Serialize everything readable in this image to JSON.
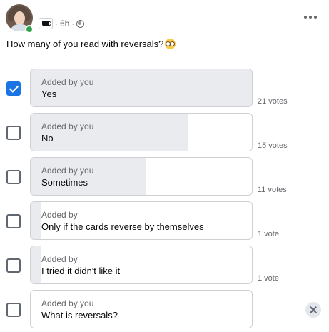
{
  "post": {
    "time": "6h",
    "text": "How many of you read with reversals?",
    "emoji": "nerd-face"
  },
  "poll": {
    "options": [
      {
        "added_by": "Added by you",
        "label": "Yes",
        "votes": "21 votes",
        "checked": true,
        "share": 1.0
      },
      {
        "added_by": "Added by you",
        "label": "No",
        "votes": "15 votes",
        "checked": false,
        "share": 0.714
      },
      {
        "added_by": "Added by you",
        "label": "Sometimes",
        "votes": "11 votes",
        "checked": false,
        "share": 0.524
      },
      {
        "added_by": "Added by",
        "label": "Only if the cards reverse by themselves",
        "votes": "1 vote",
        "checked": false,
        "share": 0.048
      },
      {
        "added_by": "Added by",
        "label": "I tried it didn't like it",
        "votes": "1 vote",
        "checked": false,
        "share": 0.048
      },
      {
        "added_by": "Added by you",
        "label": "What is reversals?",
        "votes": "",
        "checked": false,
        "share": 0.0
      }
    ]
  },
  "colors": {
    "accent": "#1b74e4",
    "fill": "#e9ebee",
    "online": "#31a24c"
  }
}
